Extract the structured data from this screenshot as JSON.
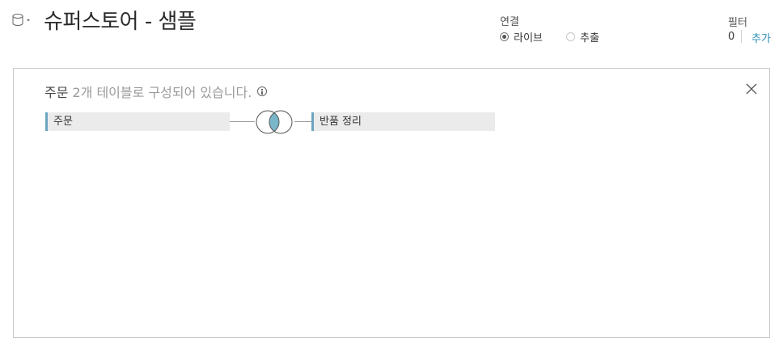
{
  "header": {
    "title": "슈퍼스토어 - 샘플",
    "connection": {
      "label": "연결",
      "options": [
        {
          "label": "라이브",
          "selected": true
        },
        {
          "label": "추출",
          "selected": false
        }
      ]
    },
    "filters": {
      "label": "필터",
      "count": "0",
      "add_label": "추가"
    }
  },
  "canvas": {
    "description": {
      "table_name": "주문",
      "rest": "2개 테이블로 구성되어 있습니다."
    },
    "tables": {
      "left": "주문",
      "right": "반품 정리"
    },
    "join": {
      "type": "inner",
      "fill_color": "#7ab6ca"
    }
  },
  "colors": {
    "accent": "#2e8fb7",
    "table_marker": "#6ca4c1"
  },
  "icons": {
    "datasource": "database-icon",
    "info": "info-icon",
    "close": "close-icon",
    "join": "inner-join-icon"
  }
}
